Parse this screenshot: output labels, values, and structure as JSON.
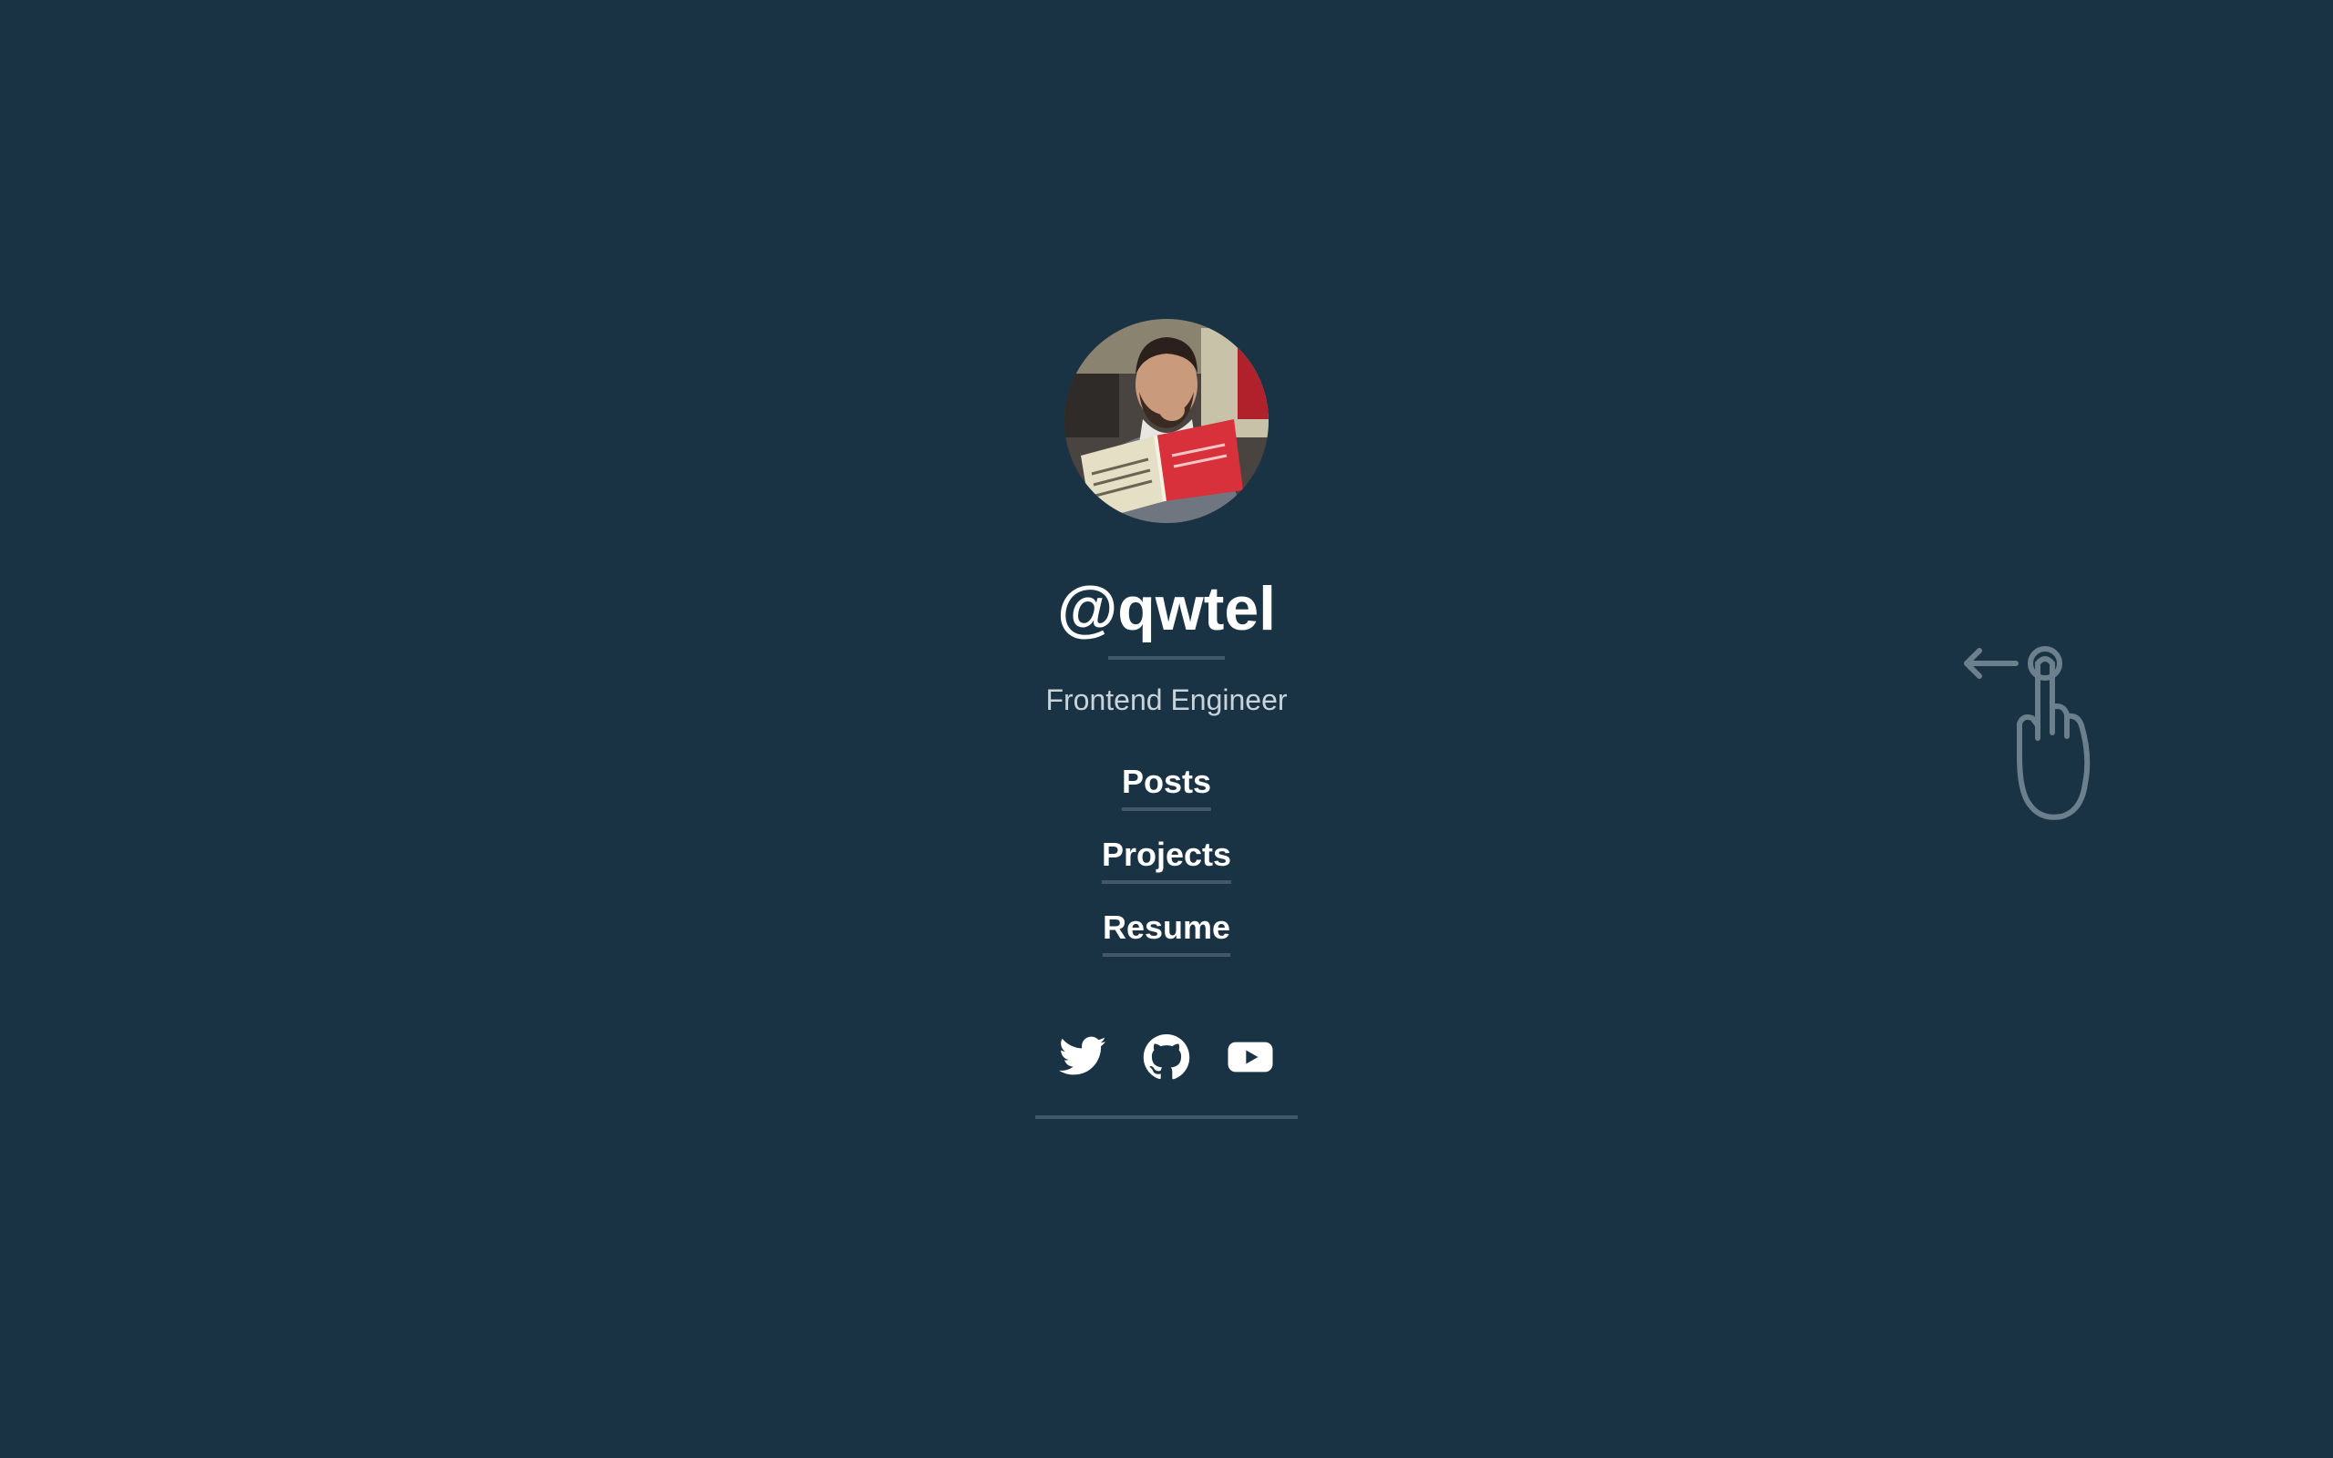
{
  "profile": {
    "handle": "@qwtel",
    "role": "Frontend Engineer"
  },
  "nav": {
    "items": [
      {
        "label": "Posts"
      },
      {
        "label": "Projects"
      },
      {
        "label": "Resume"
      }
    ]
  },
  "social": {
    "items": [
      {
        "icon": "twitter-icon"
      },
      {
        "icon": "github-icon"
      },
      {
        "icon": "youtube-icon"
      }
    ]
  },
  "hint": {
    "icon": "swipe-left-gesture-icon"
  },
  "colors": {
    "background": "#1a3344",
    "text": "#ffffff",
    "muted_text": "#c9d3da",
    "divider": "#41596a",
    "hint": "#6b7f8c"
  }
}
